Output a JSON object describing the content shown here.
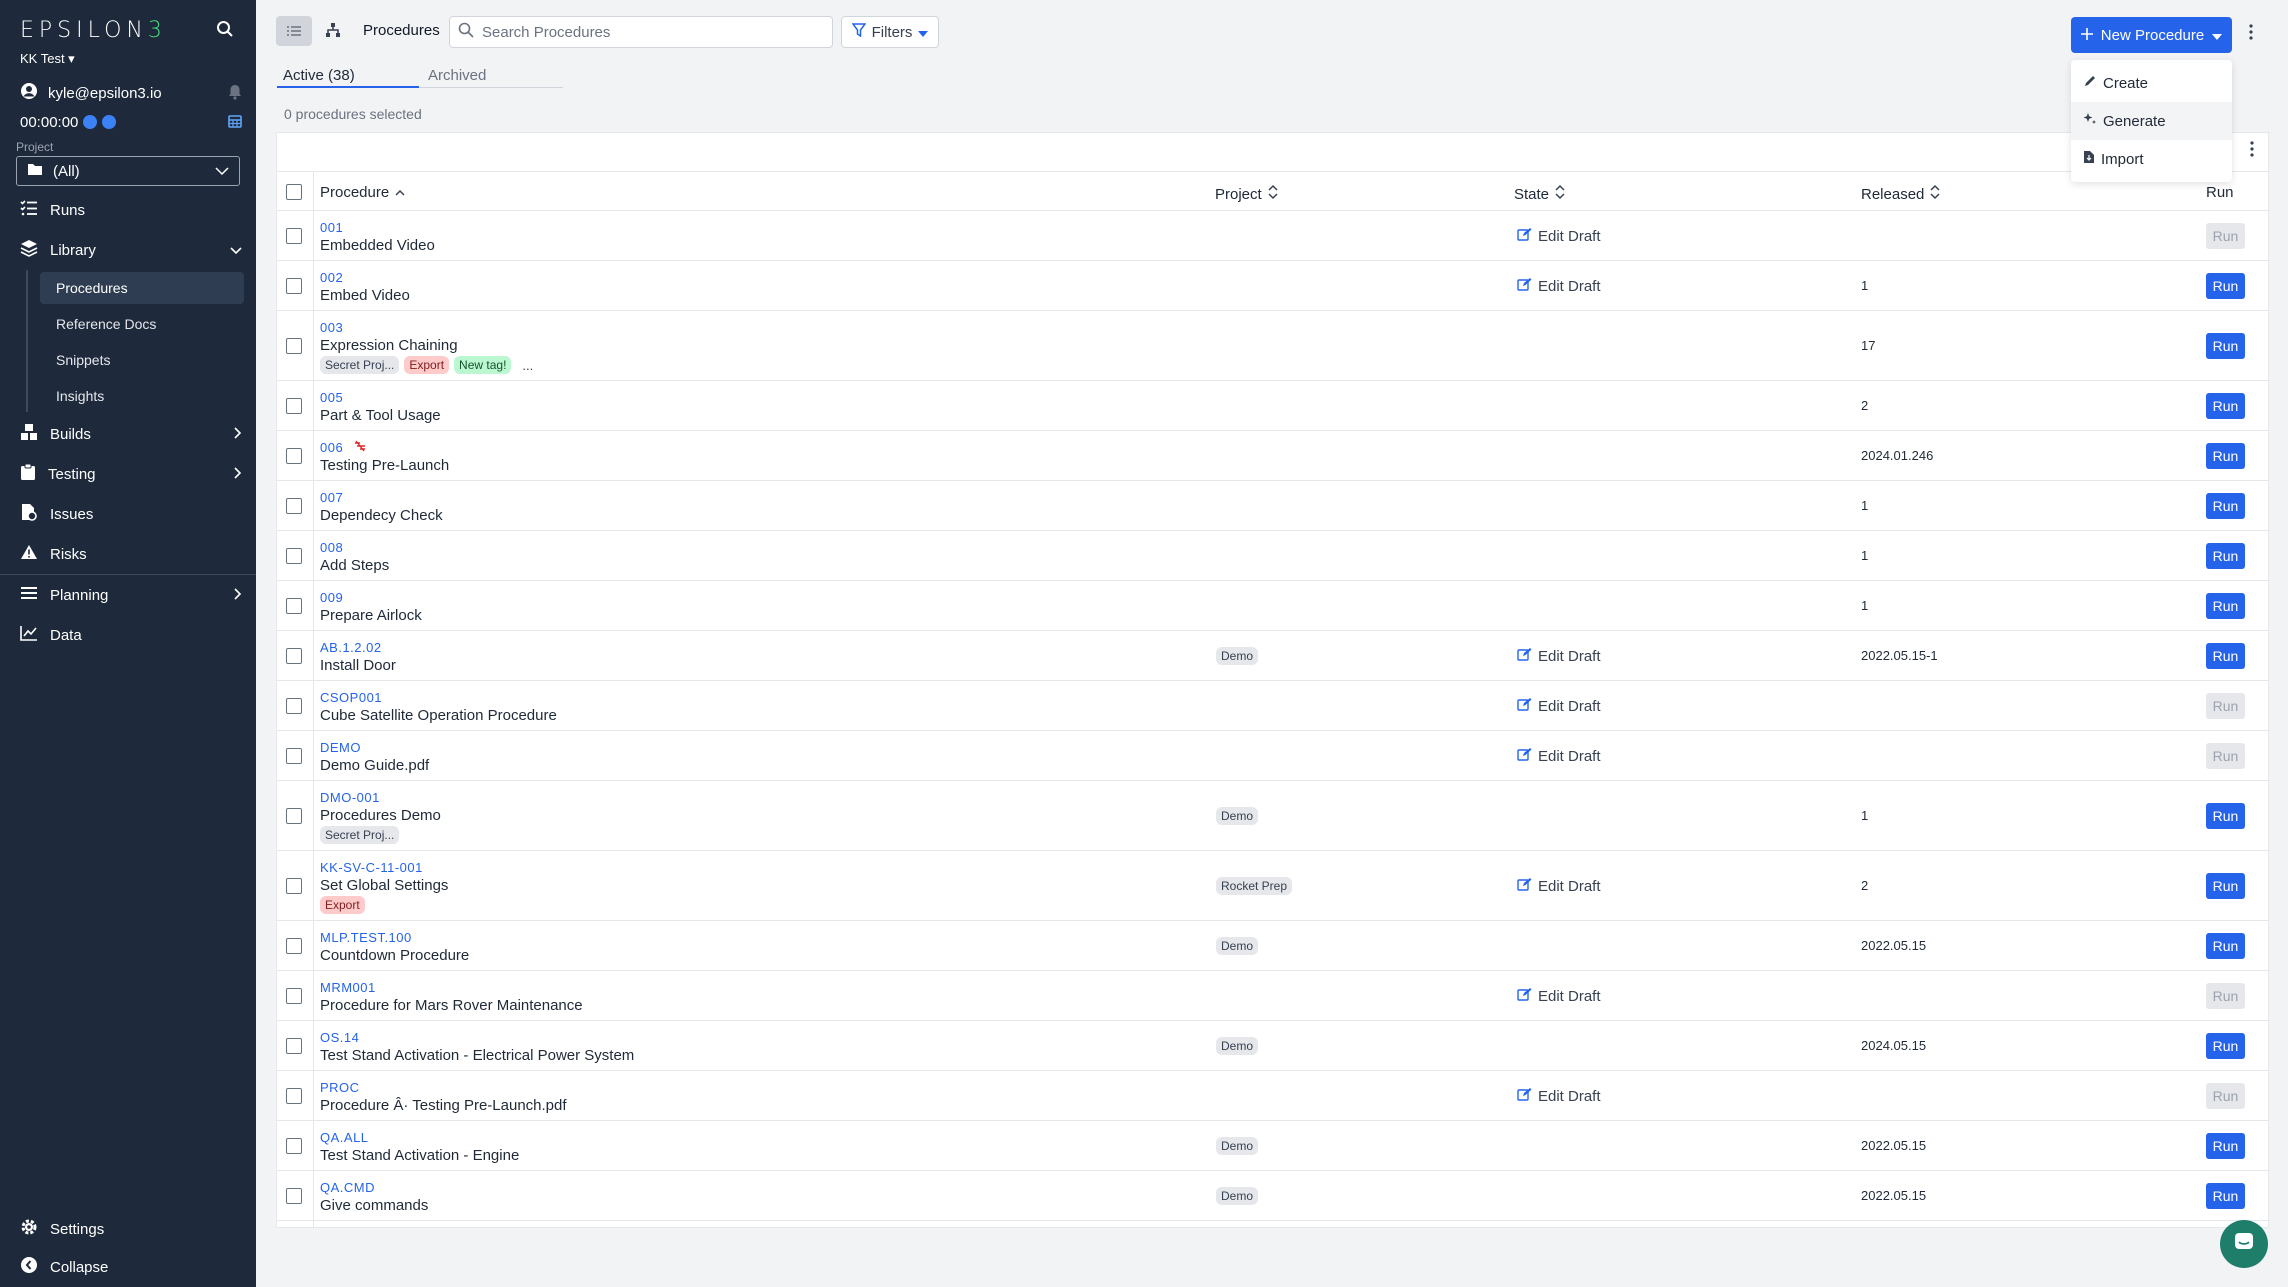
{
  "sidebar": {
    "logo_prefix": "EPSILON",
    "logo_suffix": "3",
    "workspace": "KK Test",
    "user_email": "kyle@epsilon3.io",
    "timer": "00:00:00",
    "project_label": "Project",
    "project_value": "(All)",
    "nav": {
      "runs": "Runs",
      "library": "Library",
      "procedures": "Procedures",
      "reference_docs": "Reference Docs",
      "snippets": "Snippets",
      "insights": "Insights",
      "builds": "Builds",
      "testing": "Testing",
      "issues": "Issues",
      "risks": "Risks",
      "planning": "Planning",
      "data": "Data",
      "settings": "Settings",
      "collapse": "Collapse"
    }
  },
  "header": {
    "breadcrumb": "Procedures",
    "search_placeholder": "Search Procedures",
    "filters_label": "Filters",
    "new_procedure_label": "New Procedure"
  },
  "dropdown": {
    "create": "Create",
    "generate": "Generate",
    "import": "Import"
  },
  "tabs": {
    "active": "Active (38)",
    "archived": "Archived"
  },
  "selection_status": "0 procedures selected",
  "table": {
    "headers": {
      "procedure": "Procedure",
      "project": "Project",
      "state": "State",
      "released": "Released",
      "run": "Run"
    },
    "edit_draft_label": "Edit Draft",
    "run_label": "Run",
    "rows": [
      {
        "code": "001",
        "name": "Embedded Video",
        "tags": [],
        "project": "",
        "state": "Edit Draft",
        "released": "",
        "run_enabled": false
      },
      {
        "code": "002",
        "name": "Embed Video",
        "tags": [],
        "project": "",
        "state": "Edit Draft",
        "released": "1",
        "run_enabled": true
      },
      {
        "code": "003",
        "name": "Expression Chaining",
        "tags": [
          {
            "label": "Secret Proj...",
            "color": "gray"
          },
          {
            "label": "Export",
            "color": "red"
          },
          {
            "label": "New tag!",
            "color": "green"
          }
        ],
        "tags_more": "...",
        "project": "",
        "state": "",
        "released": "17",
        "run_enabled": true
      },
      {
        "code": "005",
        "name": "Part & Tool Usage",
        "tags": [],
        "project": "",
        "state": "",
        "released": "2",
        "run_enabled": true
      },
      {
        "code": "006",
        "name": "Testing Pre-Launch",
        "tags": [],
        "project": "",
        "state": "",
        "released": "2024.01.246",
        "run_enabled": true,
        "unlinked": true
      },
      {
        "code": "007",
        "name": "Dependecy Check",
        "tags": [],
        "project": "",
        "state": "",
        "released": "1",
        "run_enabled": true
      },
      {
        "code": "008",
        "name": "Add Steps",
        "tags": [],
        "project": "",
        "state": "",
        "released": "1",
        "run_enabled": true
      },
      {
        "code": "009",
        "name": "Prepare Airlock",
        "tags": [],
        "project": "",
        "state": "",
        "released": "1",
        "run_enabled": true
      },
      {
        "code": "AB.1.2.02",
        "name": "Install Door",
        "tags": [],
        "project": "Demo",
        "state": "Edit Draft",
        "released": "2022.05.15-1",
        "run_enabled": true
      },
      {
        "code": "CSOP001",
        "name": "Cube Satellite Operation Procedure",
        "tags": [],
        "project": "",
        "state": "Edit Draft",
        "released": "",
        "run_enabled": false
      },
      {
        "code": "DEMO",
        "name": "Demo Guide.pdf",
        "tags": [],
        "project": "",
        "state": "Edit Draft",
        "released": "",
        "run_enabled": false
      },
      {
        "code": "DMO-001",
        "name": "Procedures Demo",
        "tags": [
          {
            "label": "Secret Proj...",
            "color": "gray"
          }
        ],
        "project": "Demo",
        "state": "",
        "released": "1",
        "run_enabled": true
      },
      {
        "code": "KK-SV-C-11-001",
        "name": "Set Global Settings",
        "tags": [
          {
            "label": "Export",
            "color": "red"
          }
        ],
        "project": "Rocket Prep",
        "state": "Edit Draft",
        "released": "2",
        "run_enabled": true
      },
      {
        "code": "MLP.TEST.100",
        "name": "Countdown Procedure",
        "tags": [],
        "project": "Demo",
        "state": "",
        "released": "2022.05.15",
        "run_enabled": true
      },
      {
        "code": "MRM001",
        "name": "Procedure for Mars Rover Maintenance",
        "tags": [],
        "project": "",
        "state": "Edit Draft",
        "released": "",
        "run_enabled": false
      },
      {
        "code": "OS.14",
        "name": "Test Stand Activation - Electrical Power System",
        "tags": [],
        "project": "Demo",
        "state": "",
        "released": "2024.05.15",
        "run_enabled": true
      },
      {
        "code": "PROC",
        "name": "Procedure Â· Testing Pre-Launch.pdf",
        "tags": [],
        "project": "",
        "state": "Edit Draft",
        "released": "",
        "run_enabled": false
      },
      {
        "code": "QA.ALL",
        "name": "Test Stand Activation - Engine",
        "tags": [],
        "project": "Demo",
        "state": "",
        "released": "2022.05.15",
        "run_enabled": true
      },
      {
        "code": "QA.CMD",
        "name": "Give commands",
        "tags": [],
        "project": "Demo",
        "state": "",
        "released": "2022.05.15",
        "run_enabled": true
      }
    ]
  },
  "colors": {
    "sidebar_bg": "#1e2a3b",
    "accent": "#2563eb",
    "logo_accent": "#4ade80",
    "tag_red": "#fecaca",
    "tag_green": "#bbf7d0",
    "tag_gray": "#e5e7eb"
  }
}
